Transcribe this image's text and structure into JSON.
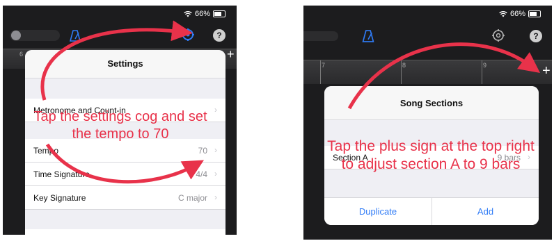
{
  "left": {
    "status": {
      "battery": "66%"
    },
    "settings_title": "Settings",
    "rows": [
      {
        "label": "Metronome and Count-in",
        "value": ""
      },
      {
        "label": "Tempo",
        "value": "70"
      },
      {
        "label": "Time Signature",
        "value": "4/4"
      },
      {
        "label": "Key Signature",
        "value": "C major"
      }
    ],
    "ruler_number": "6",
    "annotation": "Tap the settings cog and set the tempo to 70"
  },
  "right": {
    "status": {
      "battery": "66%"
    },
    "ruler_numbers": [
      "7",
      "8",
      "9"
    ],
    "song_title": "Song Sections",
    "section": {
      "label": "Section A",
      "value": "9 bars"
    },
    "buttons": {
      "duplicate": "Duplicate",
      "add": "Add"
    },
    "annotation": "Tap the plus sign at the top right to adjust section A to 9 bars"
  },
  "colors": {
    "accent": "#2f7bf6",
    "arrow": "#e8324a",
    "dark_bg": "#1c1c1e",
    "panel_bg": "#efeff4"
  },
  "icons": [
    "wifi-icon",
    "battery-icon",
    "metronome-icon",
    "gear-icon",
    "help-icon",
    "plus-icon",
    "chevron-right-icon",
    "arrow-icon"
  ]
}
